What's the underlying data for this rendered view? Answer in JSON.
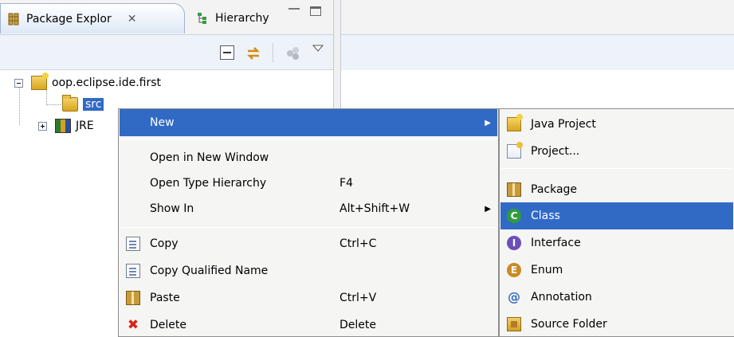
{
  "tabs": [
    {
      "label": "Package Explor",
      "close": "✕"
    },
    {
      "label": "Hierarchy"
    }
  ],
  "icons": {
    "package_explorer_tab": "package-explorer-icon",
    "hierarchy_tab": "hierarchy-icon",
    "collapse_all": "collapse-all-icon",
    "link_with_editor": "link-with-editor-icon",
    "focus": "focus-icon",
    "view_menu": "view-menu-icon"
  },
  "tree": {
    "project": "oop.eclipse.ide.first",
    "src": "src",
    "jre": "JRE"
  },
  "context_menu": {
    "items": [
      {
        "label": "New",
        "shortcut": "",
        "submenu": true,
        "highlighted": true
      },
      {
        "label": "Open in New Window",
        "shortcut": ""
      },
      {
        "label": "Open Type Hierarchy",
        "shortcut": "F4"
      },
      {
        "label": "Show In",
        "shortcut": "Alt+Shift+W",
        "submenu": true
      },
      {
        "label": "Copy",
        "shortcut": "Ctrl+C",
        "icon": "copy-icon"
      },
      {
        "label": "Copy Qualified Name",
        "shortcut": "",
        "icon": "copy-qualified-name-icon"
      },
      {
        "label": "Paste",
        "shortcut": "Ctrl+V",
        "icon": "paste-icon"
      },
      {
        "label": "Delete",
        "shortcut": "Delete",
        "icon": "delete-icon"
      }
    ]
  },
  "submenu": {
    "items": [
      {
        "label": "Java Project",
        "icon": "java-project-icon"
      },
      {
        "label": "Project...",
        "icon": "project-icon"
      },
      {
        "label": "Package",
        "icon": "package-icon"
      },
      {
        "label": "Class",
        "icon": "class-icon",
        "highlighted": true
      },
      {
        "label": "Interface",
        "icon": "interface-icon"
      },
      {
        "label": "Enum",
        "icon": "enum-icon"
      },
      {
        "label": "Annotation",
        "icon": "annotation-icon"
      },
      {
        "label": "Source Folder",
        "icon": "source-folder-icon"
      }
    ]
  },
  "colors": {
    "selection": "#316ac5",
    "menu_bg": "#f5f5f4",
    "tab_active": "#dde8f6"
  }
}
